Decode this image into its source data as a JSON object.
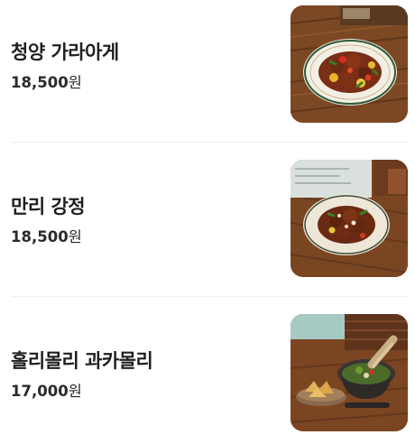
{
  "menu": {
    "items": [
      {
        "name": "청양 가라아게",
        "price": "18,500",
        "currency": "원",
        "photo": "spicy-karaage-bowl"
      },
      {
        "name": "만리 강정",
        "price": "18,500",
        "currency": "원",
        "photo": "manri-gangjeong-bowl"
      },
      {
        "name": "홀리몰리 과카몰리",
        "price": "17,000",
        "currency": "원",
        "photo": "guacamole-molcajete"
      }
    ]
  }
}
